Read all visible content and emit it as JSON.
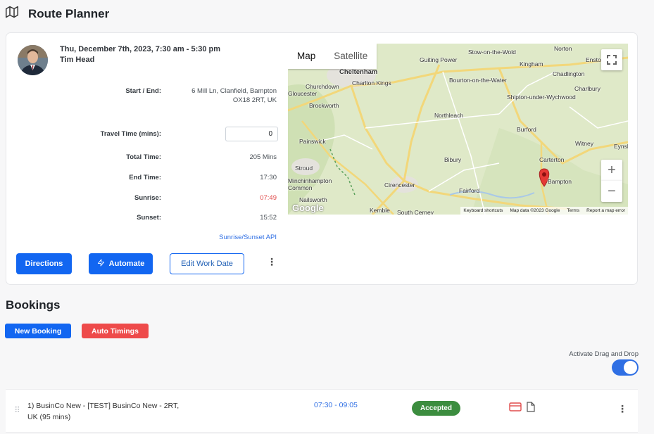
{
  "page": {
    "title": "Route Planner",
    "icon": "map-icon"
  },
  "schedule": {
    "date_line": "Thu, December 7th, 2023, 7:30 am - 5:30 pm",
    "name": "Tim Head",
    "start_end_label": "Start / End:",
    "address_line1": "6 Mill Ln, Clanfield, Bampton",
    "address_line2": "OX18 2RT, UK",
    "travel_label": "Travel Time (mins):",
    "travel_value": "0",
    "total_label": "Total Time:",
    "total_value": "205 Mins",
    "end_label": "End Time:",
    "end_value": "17:30",
    "sunrise_label": "Sunrise:",
    "sunrise_value": "07:49",
    "sunset_label": "Sunset:",
    "sunset_value": "15:52",
    "api_link": "Sunrise/Sunset API"
  },
  "actions": {
    "directions": "Directions",
    "automate": "Automate",
    "edit_work_date": "Edit Work Date"
  },
  "map": {
    "tab_map": "Map",
    "tab_satellite": "Satellite",
    "logo": "Google",
    "footer": [
      "Keyboard shortcuts",
      "Map data ©2023 Google",
      "Terms",
      "Report a map error"
    ],
    "towns": [
      "Stow-on-the-Wold",
      "Norton",
      "Guiting Power",
      "Kingham",
      "Enstone",
      "Cheltenham",
      "Charlton Kings",
      "Chadlington",
      "Gloucester",
      "Churchdown",
      "Bourton-on-the-Water",
      "Charlbury",
      "Brockworth",
      "Shipton-under-Wychwood",
      "Northleach",
      "Burford",
      "Painswick",
      "Witney",
      "Eynsham",
      "Carterton",
      "Bibury",
      "Stroud",
      "Minchinhampton Common",
      "Cirencester",
      "Fairford",
      "Bampton",
      "Nailsworth",
      "Kemble",
      "South Cerney"
    ]
  },
  "bookings": {
    "title": "Bookings",
    "new_booking": "New Booking",
    "auto_timings": "Auto Timings",
    "drag_label": "Activate Drag and Drop",
    "items": [
      {
        "title": "1) BusinCo New - [TEST] BusinCo New - 2RT, UK (95 mins)",
        "time": "07:30 - 09:05",
        "status": "Accepted"
      }
    ]
  },
  "colors": {
    "primary": "#1266f1",
    "danger": "#ee4a4a",
    "success": "#3c8d3f",
    "sunrise": "#e04c4c"
  }
}
